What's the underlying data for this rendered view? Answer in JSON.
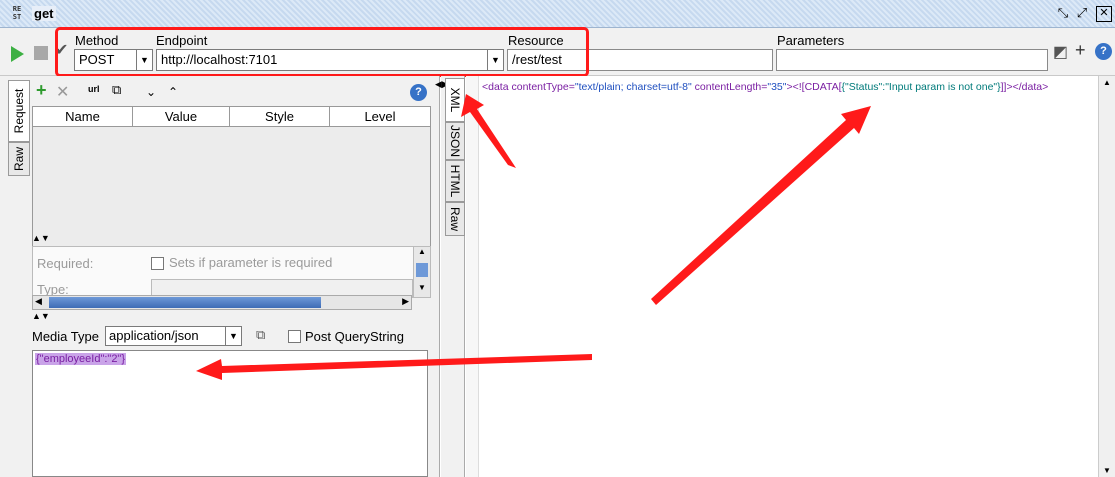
{
  "window": {
    "icon_text": "RE ST",
    "title": "get"
  },
  "toolbar": {
    "method_label": "Method",
    "method_value": "POST",
    "endpoint_label": "Endpoint",
    "endpoint_value": "http://localhost:7101",
    "resource_label": "Resource",
    "resource_value": "/rest/test",
    "parameters_label": "Parameters",
    "parameters_value": ""
  },
  "left_tabs": [
    "Request",
    "Raw"
  ],
  "params_table": {
    "columns": [
      "Name",
      "Value",
      "Style",
      "Level"
    ]
  },
  "param_details": {
    "required_label": "Required:",
    "required_checkbox_label": "Sets if parameter is required",
    "type_label": "Type:"
  },
  "media": {
    "label": "Media Type",
    "value": "application/json",
    "post_querystring_label": "Post QueryString"
  },
  "request_body": "{\"employeeId\":\"2\"}",
  "response_tabs": [
    "XML",
    "JSON",
    "HTML",
    "Raw"
  ],
  "response_xml": {
    "open_tag": "<data",
    "attr1_name": " contentType=",
    "attr1_value": "\"text/plain; charset=utf-8\"",
    "attr2_name": " contentLength=",
    "attr2_value": "\"35\"",
    "cdata_open": "><![CDATA[",
    "json_open": "{\"",
    "json_key": "Status",
    "json_sep": "\":\"",
    "json_value": "Input param is not one",
    "json_close": "\"}",
    "cdata_close": "]]></data>"
  },
  "colors": {
    "annotation_red": "#ff1a1a",
    "run_green": "#3cb043"
  }
}
